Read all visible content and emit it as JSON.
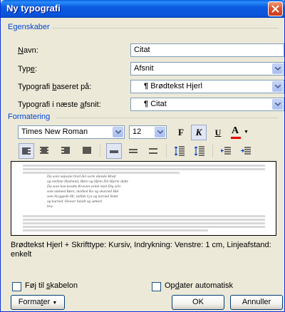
{
  "window": {
    "title": "Ny typografi"
  },
  "properties": {
    "group_label": "Egenskaber",
    "name": {
      "label_pre": "",
      "label_u": "N",
      "label_post": "avn:",
      "value": "Citat"
    },
    "type": {
      "label_pre": "Typ",
      "label_u": "e",
      "label_post": ":",
      "value": "Afsnit"
    },
    "based_on": {
      "label_pre": "Typografi ",
      "label_u": "b",
      "label_post": "aseret på:",
      "value": "Brødtekst Hjerl",
      "mark": "¶"
    },
    "next": {
      "label_pre": "Typografi i næste ",
      "label_u": "a",
      "label_post": "fsnit:",
      "value": "Citat",
      "mark": "¶"
    }
  },
  "formatting": {
    "group_label": "Formatering",
    "font": "Times New Roman",
    "size": "12",
    "bold": "F",
    "italic": "K",
    "underline": "U",
    "font_color": "A",
    "accent_color": "#e00000"
  },
  "preview": {
    "lines": [
      "Da som najsomi bred det sorte danske Brød",
      "og mellem Husband, Børn og Hjem Dit Hjerte dulte",
      "Da som han kendte Kraviet veitet med Dig selv",
      "som ammed Børn, malhed Ko og skarned Hør",
      "som bryggede Øl, sabbet Lys og karned Smør",
      "og kurned. Hosser handt og sømed",
      "bru."
    ]
  },
  "description": "Brødtekst Hjerl + Skrifttype: Kursiv, Indrykning: Venstre:  1 cm, Linjeafstand: enkelt",
  "options": {
    "add_template": {
      "pre": "Føj til ",
      "u": "s",
      "post": "kabelon"
    },
    "auto_update": {
      "pre": "Op",
      "u": "d",
      "post": "ater automatisk"
    }
  },
  "buttons": {
    "format": {
      "pre": "Forma",
      "u": "t",
      "post": "er"
    },
    "ok": "OK",
    "cancel": "Annuller"
  }
}
